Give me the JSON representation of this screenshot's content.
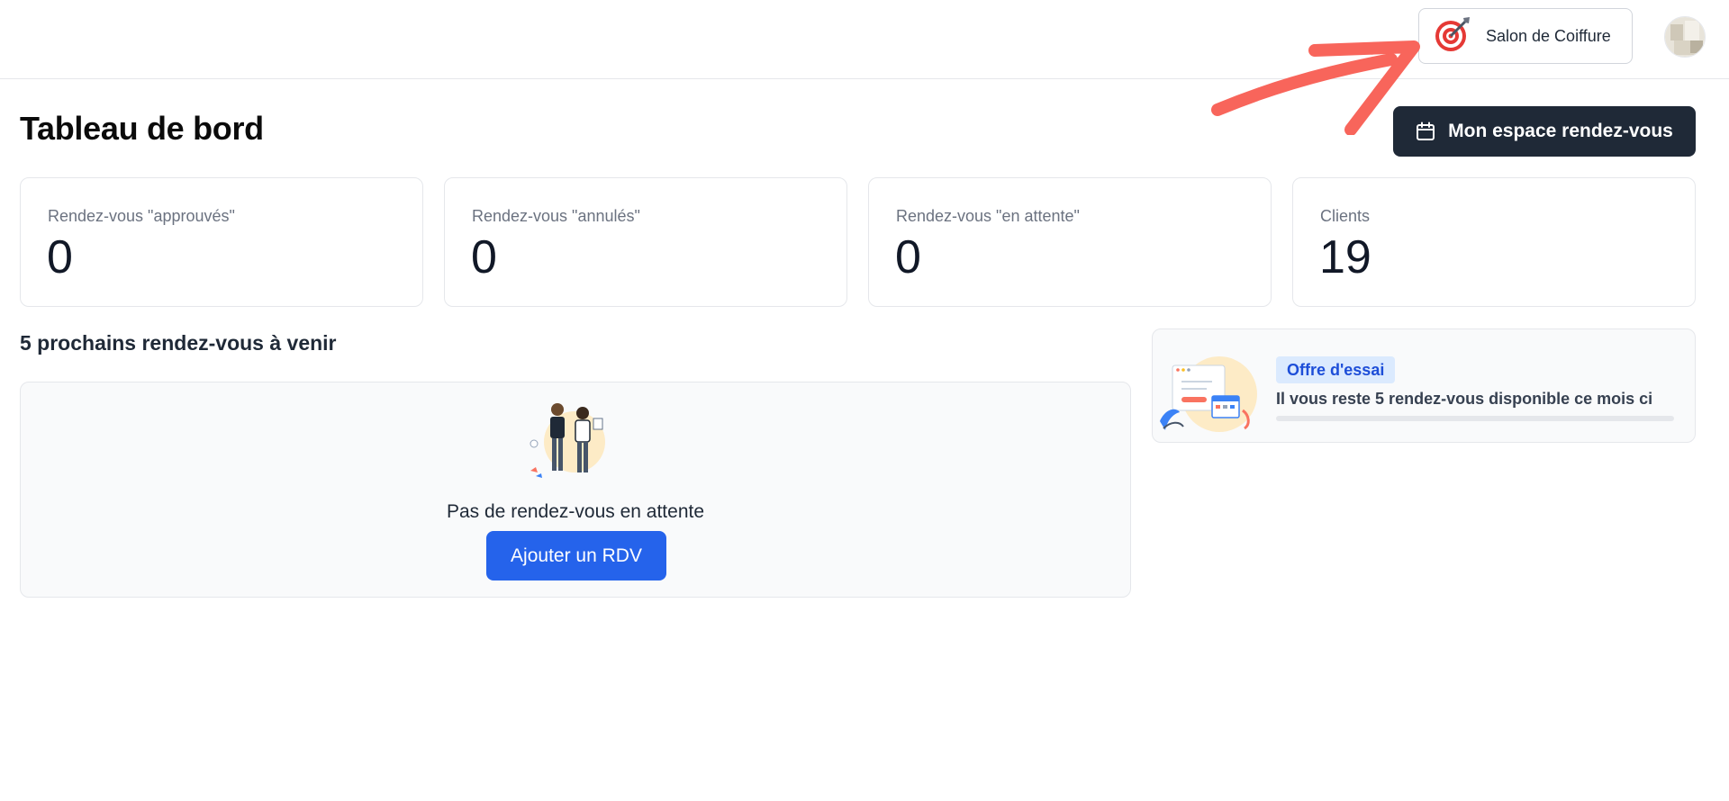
{
  "header": {
    "salon_name": "Salon de Coiffure",
    "salon_icon": "target-dart-icon",
    "avatar_icon": "user-avatar"
  },
  "main": {
    "title": "Tableau de bord",
    "appointments_space_button": "Mon espace rendez-vous",
    "appointments_space_icon": "calendar-icon"
  },
  "stats": [
    {
      "label": "Rendez-vous \"approuvés\"",
      "value": "0"
    },
    {
      "label": "Rendez-vous \"annulés\"",
      "value": "0"
    },
    {
      "label": "Rendez-vous \"en attente\"",
      "value": "0"
    },
    {
      "label": "Clients",
      "value": "19"
    }
  ],
  "upcoming": {
    "title": "5 prochains rendez-vous à venir",
    "empty_text": "Pas de rendez-vous en attente",
    "add_button": "Ajouter un RDV"
  },
  "trial": {
    "badge": "Offre d'essai",
    "text": "Il vous reste 5 rendez-vous disponible ce mois ci",
    "progress_fraction": 0
  },
  "colors": {
    "accent_dark": "#1f2937",
    "primary_blue": "#2563eb",
    "badge_bg": "#dbeafe",
    "badge_text": "#1d4ed8",
    "annotation_arrow": "#f8655b"
  }
}
